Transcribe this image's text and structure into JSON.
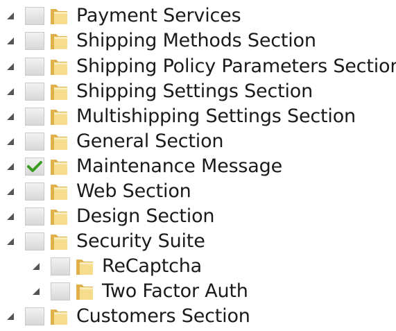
{
  "tree": {
    "nodes": [
      {
        "label": "Payment Services",
        "checked": false,
        "level": 0
      },
      {
        "label": "Shipping Methods Section",
        "checked": false,
        "level": 0
      },
      {
        "label": "Shipping Policy Parameters Section",
        "checked": false,
        "level": 0
      },
      {
        "label": "Shipping Settings Section",
        "checked": false,
        "level": 0
      },
      {
        "label": "Multishipping Settings Section",
        "checked": false,
        "level": 0
      },
      {
        "label": "General Section",
        "checked": false,
        "level": 0
      },
      {
        "label": "Maintenance Message",
        "checked": true,
        "level": 0
      },
      {
        "label": "Web Section",
        "checked": false,
        "level": 0
      },
      {
        "label": "Design Section",
        "checked": false,
        "level": 0
      },
      {
        "label": "Security Suite",
        "checked": false,
        "level": 0
      },
      {
        "label": "ReCaptcha",
        "checked": false,
        "level": 1
      },
      {
        "label": "Two Factor Auth",
        "checked": false,
        "level": 1
      },
      {
        "label": "Customers Section",
        "checked": false,
        "level": 0
      }
    ]
  },
  "colors": {
    "check": "#3a9d23",
    "folder_light": "#f6dd8e",
    "folder_dark": "#e0b04a",
    "toggle": "#555555"
  }
}
